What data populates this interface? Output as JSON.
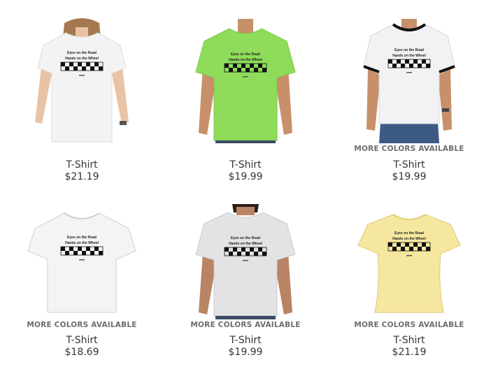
{
  "products": [
    {
      "name": "T-Shirt",
      "price": "$21.19",
      "more_colors": "",
      "shirt_color": "#f3f3f3",
      "design_line1": "Eyes on the Road",
      "design_line2": "Hands on the Wheel",
      "model": "woman"
    },
    {
      "name": "T-Shirt",
      "price": "$19.99",
      "more_colors": "",
      "shirt_color": "#8fdc5a",
      "design_line1": "Eyes on the Road",
      "design_line2": "Hands on the Wheel",
      "model": "man"
    },
    {
      "name": "T-Shirt",
      "price": "$19.99",
      "more_colors": "MORE COLORS AVAILABLE",
      "shirt_color": "#f2f2f4",
      "design_line1": "Eyes on the Road",
      "design_line2": "Hands on the Wheel",
      "model": "man-ringer"
    },
    {
      "name": "T-Shirt",
      "price": "$18.69",
      "more_colors": "MORE COLORS AVAILABLE",
      "shirt_color": "#f4f4f4",
      "design_line1": "Eyes on the Road",
      "design_line2": "Hands on the Wheel",
      "model": "flat-kids"
    },
    {
      "name": "T-Shirt",
      "price": "$19.99",
      "more_colors": "MORE COLORS AVAILABLE",
      "shirt_color": "#e3e3e6",
      "design_line1": "Eyes on the Road",
      "design_line2": "Hands on the Wheel",
      "model": "man"
    },
    {
      "name": "T-Shirt",
      "price": "$21.19",
      "more_colors": "MORE COLORS AVAILABLE",
      "shirt_color": "#f6e7a0",
      "design_line1": "Eyes on the Road",
      "design_line2": "Hands on the Wheel",
      "model": "flat-girls"
    }
  ]
}
